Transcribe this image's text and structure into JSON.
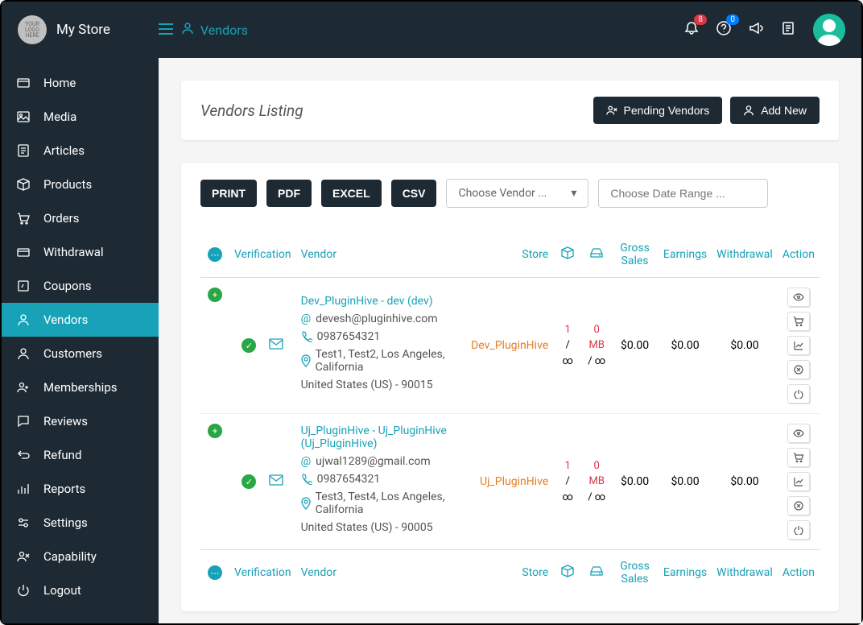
{
  "header": {
    "logo_text": "YOUR LOGO HERE",
    "store_name": "My Store",
    "breadcrumb": "Vendors",
    "notif_badge": "8",
    "help_badge": "0"
  },
  "sidebar": {
    "items": [
      {
        "label": "Home"
      },
      {
        "label": "Media"
      },
      {
        "label": "Articles"
      },
      {
        "label": "Products"
      },
      {
        "label": "Orders"
      },
      {
        "label": "Withdrawal"
      },
      {
        "label": "Coupons"
      },
      {
        "label": "Vendors"
      },
      {
        "label": "Customers"
      },
      {
        "label": "Memberships"
      },
      {
        "label": "Reviews"
      },
      {
        "label": "Refund"
      },
      {
        "label": "Reports"
      },
      {
        "label": "Settings"
      },
      {
        "label": "Capability"
      },
      {
        "label": "Logout"
      }
    ]
  },
  "page": {
    "title": "Vendors Listing",
    "pending_btn": "Pending Vendors",
    "add_btn": "Add New"
  },
  "toolbar": {
    "print": "PRINT",
    "pdf": "PDF",
    "excel": "EXCEL",
    "csv": "CSV",
    "vendor_select": "Choose Vendor ...",
    "date_placeholder": "Choose Date Range ..."
  },
  "columns": {
    "verification": "Verification",
    "vendor": "Vendor",
    "store": "Store",
    "gross_sales": "Gross Sales",
    "earnings": "Earnings",
    "withdrawal": "Withdrawal",
    "action": "Action"
  },
  "rows": [
    {
      "name": "Dev_PluginHive - dev (dev)",
      "email": "devesh@pluginhive.com",
      "phone": "0987654321",
      "addr1": "Test1, Test2, Los Angeles, California",
      "addr2": "United States (US) - 90015",
      "store": "Dev_PluginHive",
      "box_top": "1",
      "box_sep": "/",
      "box_bot": "∞",
      "disk_top": "0 MB",
      "disk_bot": "/ ∞",
      "gross": "$0.00",
      "earnings": "$0.00",
      "withdrawal": "$0.00"
    },
    {
      "name": "Uj_PluginHive - Uj_PluginHive (Uj_PluginHive)",
      "email": "ujwal1289@gmail.com",
      "phone": "0987654321",
      "addr1": "Test3, Test4, Los Angeles, California",
      "addr2": "United States (US) - 90005",
      "store": "Uj_PluginHive",
      "box_top": "1",
      "box_sep": "/",
      "box_bot": "∞",
      "disk_top": "0 MB",
      "disk_bot": "/ ∞",
      "gross": "$0.00",
      "earnings": "$0.00",
      "withdrawal": "$0.00"
    }
  ]
}
